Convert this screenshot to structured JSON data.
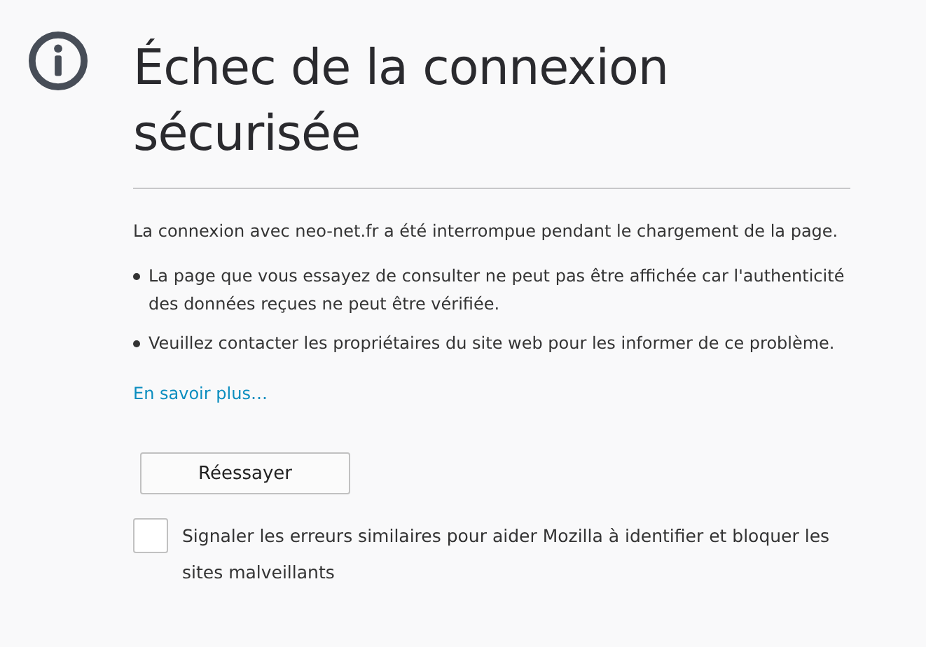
{
  "title": "Échec de la connexion sécurisée",
  "message": "La connexion avec neo-net.fr a été interrompue pendant le chargement de la page.",
  "bullets": [
    "La page que vous essayez de consulter ne peut pas être affichée car l'authenticité des données reçues ne peut être vérifiée.",
    "Veuillez contacter les propriétaires du site web pour les informer de ce problème."
  ],
  "learn_more_link": "En savoir plus…",
  "retry_button": "Réessayer",
  "report_option": {
    "label": "Signaler les erreurs similaires pour aider Mozilla à identifier et bloquer les sites malveillants",
    "checked": false
  }
}
